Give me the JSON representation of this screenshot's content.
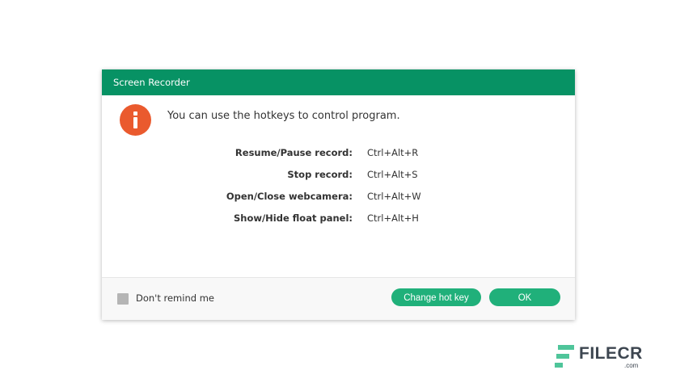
{
  "dialog": {
    "title": "Screen Recorder",
    "message": "You can use the hotkeys to control program.",
    "hotkeys": [
      {
        "action": "Resume/Pause record:",
        "keys": "Ctrl+Alt+R"
      },
      {
        "action": "Stop record:",
        "keys": "Ctrl+Alt+S"
      },
      {
        "action": "Open/Close webcamera:",
        "keys": "Ctrl+Alt+W"
      },
      {
        "action": "Show/Hide float panel:",
        "keys": "Ctrl+Alt+H"
      }
    ],
    "footer": {
      "checkbox_label": "Don't remind me",
      "checkbox_checked": false,
      "change_hotkey_label": "Change hot key",
      "ok_label": "OK"
    }
  },
  "watermark": {
    "brand": "FILECR",
    "suffix": ".com"
  },
  "colors": {
    "titlebar": "#079264",
    "button": "#20b07a",
    "info_icon": "#ea5a2e"
  },
  "icons": {
    "info": "info-icon",
    "checkbox": "checkbox-icon",
    "watermark_logo": "filecr-logo-icon"
  }
}
